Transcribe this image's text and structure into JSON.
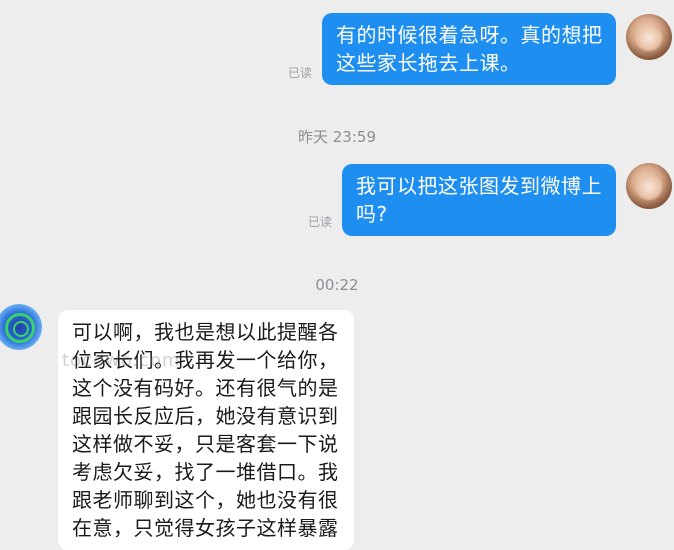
{
  "messages": [
    {
      "direction": "outgoing",
      "lines": [
        "有的时候很着急呀。真的想把",
        "这些家长拖去上课。"
      ],
      "status": "已读"
    },
    {
      "separator": "昨天 23:59"
    },
    {
      "direction": "outgoing",
      "lines": [
        "我可以把这张图发到微博上",
        "吗?"
      ],
      "status": "已读"
    },
    {
      "separator": "00:22"
    },
    {
      "direction": "incoming",
      "lines": [
        "可以啊，我也是想以此提醒各",
        "位家长们。我再发一个给你，",
        "这个没有码好。还有很气的是",
        "跟园长反应后，她没有意识到",
        "这样做不妥，只是客套一下说",
        "考虑欠妥，找了一堆借口。我",
        "跟老师聊到这个，她也没有很",
        "在意，只觉得女孩子这样暴露"
      ]
    }
  ],
  "colors": {
    "background": "#ededed",
    "outgoing_bubble": "#1e8ff0",
    "incoming_bubble": "#ffffff"
  },
  "icons": {
    "my_avatar": "avatar-photo",
    "contact_avatar": "avatar-logo"
  },
  "watermark": "tocowo.com"
}
